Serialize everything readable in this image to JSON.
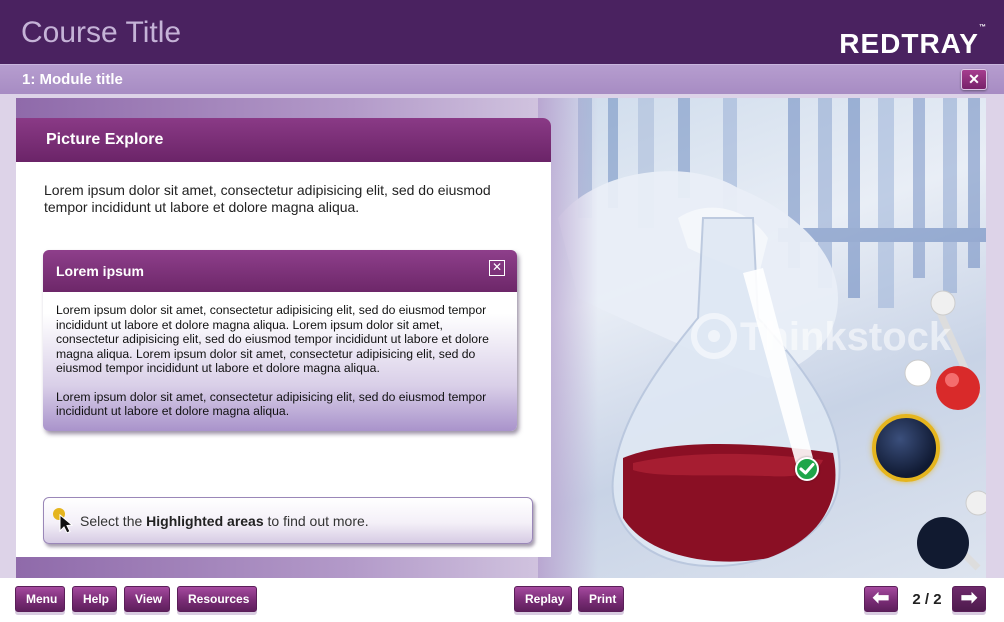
{
  "header": {
    "course_title": "Course Title",
    "logo_text": "REDTRAY",
    "logo_mark": "™"
  },
  "module": {
    "title": "1: Module title",
    "close_icon": "close-icon"
  },
  "panel": {
    "title": "Picture Explore",
    "intro": "Lorem ipsum dolor sit amet, consectetur adipisicing elit, sed do eiusmod tempor incididunt ut labore et dolore magna aliqua."
  },
  "popup": {
    "title": "Lorem ipsum",
    "close_icon": "close-icon",
    "paragraphs": [
      "Lorem ipsum dolor sit amet, consectetur adipisicing elit, sed do eiusmod tempor incididunt ut labore et dolore magna aliqua. Lorem ipsum dolor sit amet, consectetur adipisicing elit, sed do eiusmod tempor incididunt ut labore et dolore magna aliqua. Lorem ipsum dolor sit amet, consectetur adipisicing elit, sed do eiusmod tempor incididunt ut labore et dolore magna aliqua.",
      "Lorem ipsum dolor sit amet, consectetur adipisicing elit, sed do eiusmod tempor incididunt ut labore et dolore magna aliqua."
    ]
  },
  "instruction": {
    "prefix": "Select the ",
    "highlight": "Highlighted areas",
    "suffix": " to find out more.",
    "icon": "pointer-cursor-icon"
  },
  "image": {
    "watermark": "Thinkstock",
    "hotspots": [
      "checkmark-hotspot",
      "highlight-ring-hotspot"
    ]
  },
  "footer": {
    "menu": "Menu",
    "help": "Help",
    "view": "View",
    "resources": "Resources",
    "replay": "Replay",
    "print": "Print",
    "prev_icon": "arrow-left-icon",
    "next_icon": "arrow-right-icon",
    "page": "2 / 2"
  },
  "colors": {
    "header_bg": "#4a2260",
    "module_bar": "#b69dcf",
    "accent_purple": "#7a2d76",
    "highlight_gold": "#e5b51e",
    "check_green": "#1fa64a"
  }
}
